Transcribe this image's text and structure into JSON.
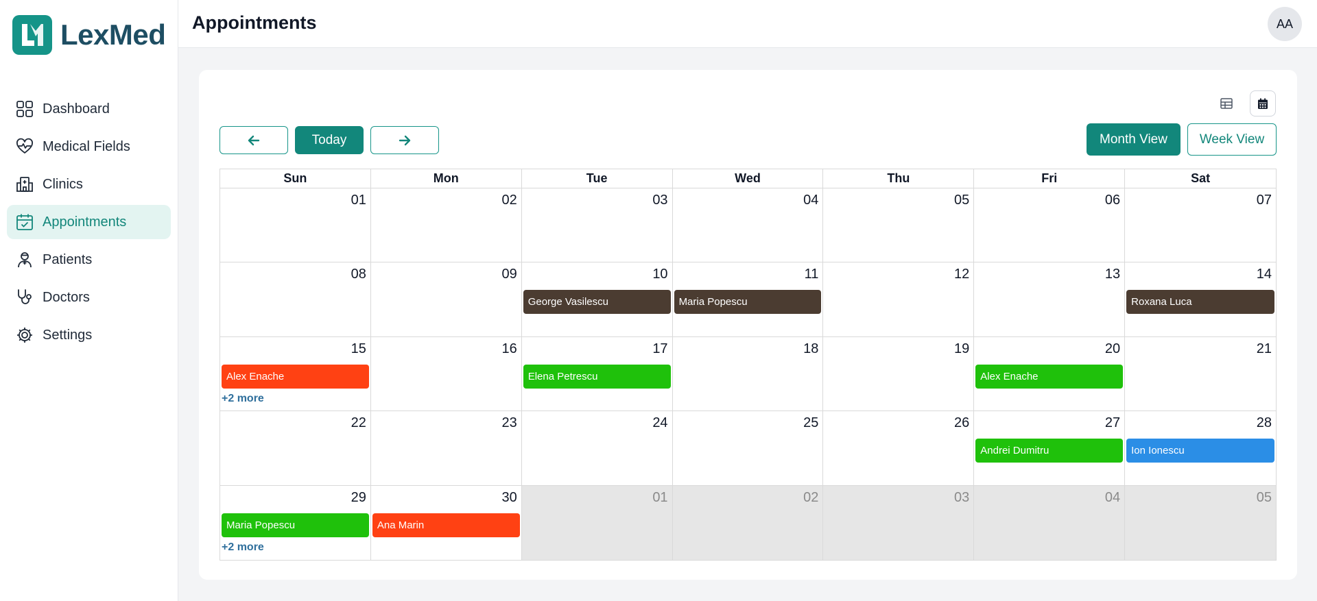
{
  "app": {
    "logo_text": "LexMed"
  },
  "sidebar": {
    "items": [
      {
        "label": "Dashboard",
        "icon": "dashboard-grid-icon",
        "active": false
      },
      {
        "label": "Medical Fields",
        "icon": "heart-pulse-icon",
        "active": false
      },
      {
        "label": "Clinics",
        "icon": "building-icon",
        "active": false
      },
      {
        "label": "Appointments",
        "icon": "calendar-check-icon",
        "active": true
      },
      {
        "label": "Patients",
        "icon": "patient-icon",
        "active": false
      },
      {
        "label": "Doctors",
        "icon": "stethoscope-icon",
        "active": false
      },
      {
        "label": "Settings",
        "icon": "gear-icon",
        "active": false
      }
    ]
  },
  "header": {
    "title": "Appointments",
    "avatar_initials": "AA"
  },
  "toolbar": {
    "today_label": "Today",
    "month_view_label": "Month View",
    "week_view_label": "Week View"
  },
  "colors": {
    "accent": "#12877b",
    "brand": "#159488",
    "event_brown": "#4b3c31",
    "event_orange": "#ff4113",
    "event_green": "#1fc10b",
    "event_blue": "#2b8ee6"
  },
  "calendar": {
    "weekdays": [
      "Sun",
      "Mon",
      "Tue",
      "Wed",
      "Thu",
      "Fri",
      "Sat"
    ],
    "weeks": [
      [
        {
          "day": "01"
        },
        {
          "day": "02"
        },
        {
          "day": "03"
        },
        {
          "day": "04"
        },
        {
          "day": "05"
        },
        {
          "day": "06"
        },
        {
          "day": "07"
        }
      ],
      [
        {
          "day": "08"
        },
        {
          "day": "09"
        },
        {
          "day": "10",
          "event": "George Vasilescu",
          "color": "#4b3c31"
        },
        {
          "day": "11",
          "event": "Maria Popescu",
          "color": "#4b3c31"
        },
        {
          "day": "12"
        },
        {
          "day": "13"
        },
        {
          "day": "14",
          "event": "Roxana Luca",
          "color": "#4b3c31"
        }
      ],
      [
        {
          "day": "15",
          "event": "Alex Enache",
          "color": "#ff4113",
          "more": "+2 more"
        },
        {
          "day": "16"
        },
        {
          "day": "17",
          "event": "Elena Petrescu",
          "color": "#1fc10b"
        },
        {
          "day": "18"
        },
        {
          "day": "19"
        },
        {
          "day": "20",
          "event": "Alex Enache",
          "color": "#1fc10b"
        },
        {
          "day": "21"
        }
      ],
      [
        {
          "day": "22"
        },
        {
          "day": "23"
        },
        {
          "day": "24"
        },
        {
          "day": "25"
        },
        {
          "day": "26"
        },
        {
          "day": "27",
          "event": "Andrei Dumitru",
          "color": "#1fc10b"
        },
        {
          "day": "28",
          "event": "Ion Ionescu",
          "color": "#2b8ee6"
        }
      ],
      [
        {
          "day": "29",
          "event": "Maria Popescu",
          "color": "#1fc10b",
          "more": "+2 more"
        },
        {
          "day": "30",
          "event": "Ana Marin",
          "color": "#ff4113"
        },
        {
          "day": "01",
          "outside": true
        },
        {
          "day": "02",
          "outside": true
        },
        {
          "day": "03",
          "outside": true
        },
        {
          "day": "04",
          "outside": true
        },
        {
          "day": "05",
          "outside": true
        }
      ]
    ]
  }
}
